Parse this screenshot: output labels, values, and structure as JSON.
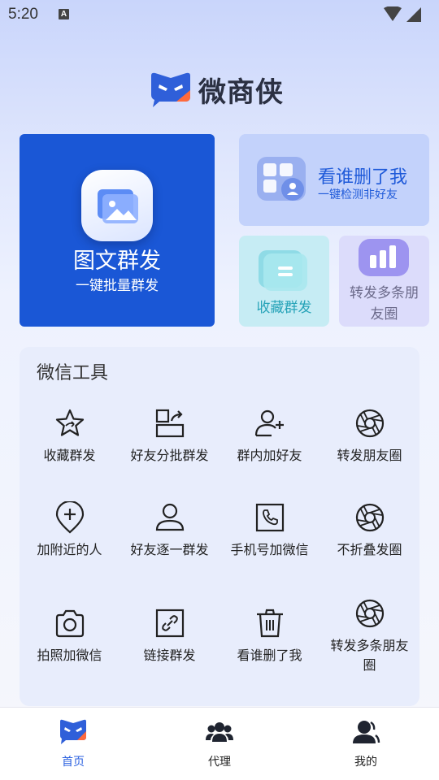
{
  "status_bar": {
    "time": "5:20",
    "notification_glyph": "A"
  },
  "app": {
    "name": "微商侠"
  },
  "feature_cards": {
    "main": {
      "title": "图文群发",
      "subtitle": "一键批量群发",
      "icon": "image-icon"
    },
    "check_deleted": {
      "title": "看谁删了我",
      "subtitle": "一键检测非好友",
      "icon": "contacts-grid-icon"
    },
    "favorites_broadcast": {
      "title": "收藏群发",
      "icon": "favorites-icon"
    },
    "forward_moments": {
      "title": "转发多条朋友圈",
      "icon": "chart-bubble-icon"
    }
  },
  "tools": {
    "title": "微信工具",
    "items": [
      {
        "label": "收藏群发",
        "icon": "star-icon"
      },
      {
        "label": "好友分批群发",
        "icon": "batch-send-icon"
      },
      {
        "label": "群内加好友",
        "icon": "add-person-icon"
      },
      {
        "label": "转发朋友圈",
        "icon": "aperture-icon"
      },
      {
        "label": "加附近的人",
        "icon": "location-plus-icon"
      },
      {
        "label": "好友逐一群发",
        "icon": "person-icon"
      },
      {
        "label": "手机号加微信",
        "icon": "phone-icon"
      },
      {
        "label": "不折叠发圈",
        "icon": "aperture-icon"
      },
      {
        "label": "拍照加微信",
        "icon": "camera-icon"
      },
      {
        "label": "链接群发",
        "icon": "link-icon"
      },
      {
        "label": "看谁删了我",
        "icon": "trash-icon"
      },
      {
        "label": "转发多条朋友圈",
        "icon": "aperture-icon"
      }
    ]
  },
  "bottom_nav": {
    "items": [
      {
        "label": "首页",
        "icon": "home-logo-icon",
        "active": true
      },
      {
        "label": "代理",
        "icon": "agents-icon",
        "active": false
      },
      {
        "label": "我的",
        "icon": "profile-icon",
        "active": false
      }
    ]
  },
  "colors": {
    "primary": "#1a57d6",
    "accent": "#2c62e0",
    "brand_orange": "#ff6a3d",
    "delete_card": "#c3d2fb",
    "favorites_card": "#c6ecf4",
    "forward_card": "#dcdcfb",
    "tools_panel": "#e8edfc"
  }
}
